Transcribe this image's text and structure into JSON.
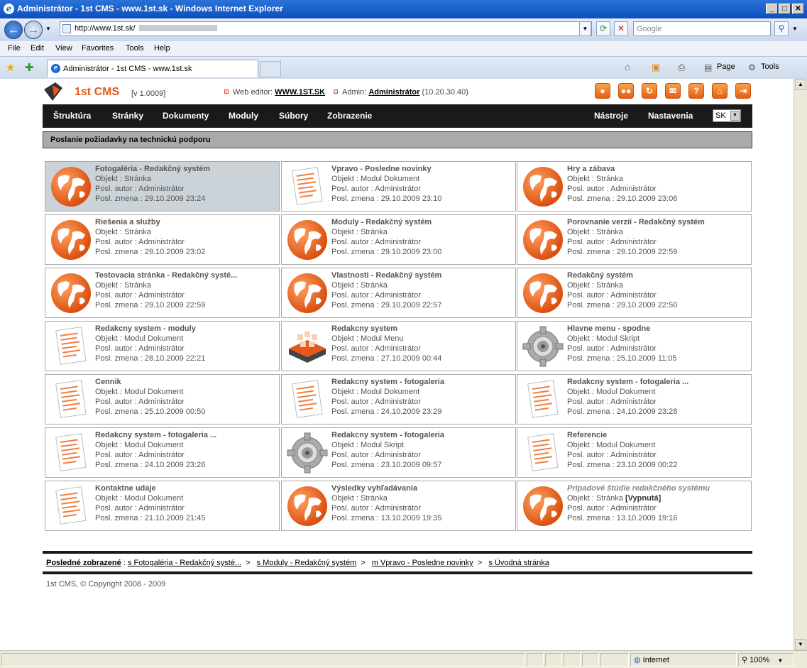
{
  "window": {
    "title": "Administrátor - 1st CMS - www.1st.sk - Windows Internet Explorer"
  },
  "browser": {
    "url": "http://www.1st.sk/",
    "search_placeholder": "Google",
    "menu": [
      "File",
      "Edit",
      "View",
      "Favorites",
      "Tools",
      "Help"
    ],
    "tab_title": "Administrátor - 1st CMS - www.1st.sk",
    "cmd_page": "Page",
    "cmd_tools": "Tools",
    "status_zone": "Internet",
    "zoom": "100%"
  },
  "cms": {
    "brand": "1st CMS",
    "version": "[v 1.0009]",
    "web_editor_label": "Web editor:",
    "web_editor_value": "WWW.1ST.SK",
    "admin_label": "Admin:",
    "admin_value": "Administrátor",
    "admin_ip": "(10.20.30.40)",
    "toolbar_icons": [
      "user-icon",
      "users-icon",
      "refresh-icon",
      "mail-icon",
      "help-icon",
      "home-icon",
      "logout-icon"
    ],
    "nav": [
      "Štruktúra",
      "Stránky",
      "Dokumenty",
      "Moduly",
      "Súbory",
      "Zobrazenie"
    ],
    "nav_right": [
      "Nástroje",
      "Nastavenia"
    ],
    "lang": "SK",
    "page_title": "Poslanie požiadavky na technickú podporu",
    "labels": {
      "obj": "Objekt : ",
      "author": "Posl. autor : ",
      "changed": "Posl. zmena : "
    },
    "cards": [
      {
        "title": "Fotogaléria - Redakčný systém",
        "obj": "Stránka",
        "author": "Administrátor",
        "date": "29.10.2009 23:24",
        "icon": "globe"
      },
      {
        "title": "Vpravo - Posledne novinky",
        "obj": "Modul Dokument",
        "author": "Administrátor",
        "date": "29.10.2009 23:10",
        "icon": "document"
      },
      {
        "title": "Hry a zábava",
        "obj": "Stránka",
        "author": "Administrátor",
        "date": "29.10.2009 23:06",
        "icon": "globe"
      },
      {
        "title": "Riešenia a služby",
        "obj": "Stránka",
        "author": "Administrátor",
        "date": "29.10.2009 23:02",
        "icon": "globe"
      },
      {
        "title": "Moduly - Redakčný systém",
        "obj": "Stránka",
        "author": "Administrátor",
        "date": "29.10.2009 23:00",
        "icon": "globe"
      },
      {
        "title": "Porovnanie verzií - Redakčný systém",
        "obj": "Stránka",
        "author": "Administrátor",
        "date": "29.10.2009 22:59",
        "icon": "globe"
      },
      {
        "title": "Testovacia stránka - Redakčný systé...",
        "obj": "Stránka",
        "author": "Administrátor",
        "date": "29.10.2009 22:59",
        "icon": "globe"
      },
      {
        "title": "Vlastnosti - Redakčný systém",
        "obj": "Stránka",
        "author": "Administrátor",
        "date": "29.10.2009 22:57",
        "icon": "globe"
      },
      {
        "title": "Redakčný systém",
        "obj": "Stránka",
        "author": "Administrátor",
        "date": "29.10.2009 22:50",
        "icon": "globe"
      },
      {
        "title": "Redakcny system - moduly",
        "obj": "Modul Dokument",
        "author": "Administrátor",
        "date": "28.10.2009 22:21",
        "icon": "document"
      },
      {
        "title": "Redakcny system",
        "obj": "Modul Menu",
        "author": "Administrátor",
        "date": "27.10.2009 00:44",
        "icon": "menu"
      },
      {
        "title": "Hlavne menu - spodne",
        "obj": "Modul Skript",
        "author": "Administrátor",
        "date": "25.10.2009 11:05",
        "icon": "gear"
      },
      {
        "title": "Cennik",
        "obj": "Modul Dokument",
        "author": "Administrátor",
        "date": "25.10.2009 00:50",
        "icon": "document"
      },
      {
        "title": "Redakcny system - fotogaleria",
        "obj": "Modul Dokument",
        "author": "Administrátor",
        "date": "24.10.2009 23:29",
        "icon": "document"
      },
      {
        "title": "Redakcny system - fotogaleria ...",
        "obj": "Modul Dokument",
        "author": "Administrátor",
        "date": "24.10.2009 23:28",
        "icon": "document"
      },
      {
        "title": "Redakcny system - fotogaleria ...",
        "obj": "Modul Dokument",
        "author": "Administrátor",
        "date": "24.10.2009 23:26",
        "icon": "document"
      },
      {
        "title": "Redakcny system - fotogaleria",
        "obj": "Modul Skript",
        "author": "Administrátor",
        "date": "23.10.2009 09:57",
        "icon": "gear"
      },
      {
        "title": "Referencie",
        "obj": "Modul Dokument",
        "author": "Administrátor",
        "date": "23.10.2009 00:22",
        "icon": "document"
      },
      {
        "title": "Kontaktne udaje",
        "obj": "Modul Dokument",
        "author": "Administrátor",
        "date": "21.10.2009 21:45",
        "icon": "document"
      },
      {
        "title": "Výsledky vyhľadávania",
        "obj": "Stránka",
        "author": "Administrátor",
        "date": "13.10.2009 19:35",
        "icon": "globe"
      },
      {
        "title": "Prípadové štúdie redakčného systému",
        "obj": "Stránka",
        "obj_extra": "[Vypnutá]",
        "author": "Administrátor",
        "date": "13.10.2009 19:16",
        "icon": "globe",
        "disabled": true
      }
    ],
    "history_label": "Posledné zobrazené",
    "history": [
      "s Fotogaléria - Redakčný systé...",
      "s Moduly - Redakčný systém",
      "m Vpravo - Posledne novinky",
      "s Úvodná stránka"
    ],
    "copyright": "1st CMS, © Copyright 2008 - 2009"
  }
}
